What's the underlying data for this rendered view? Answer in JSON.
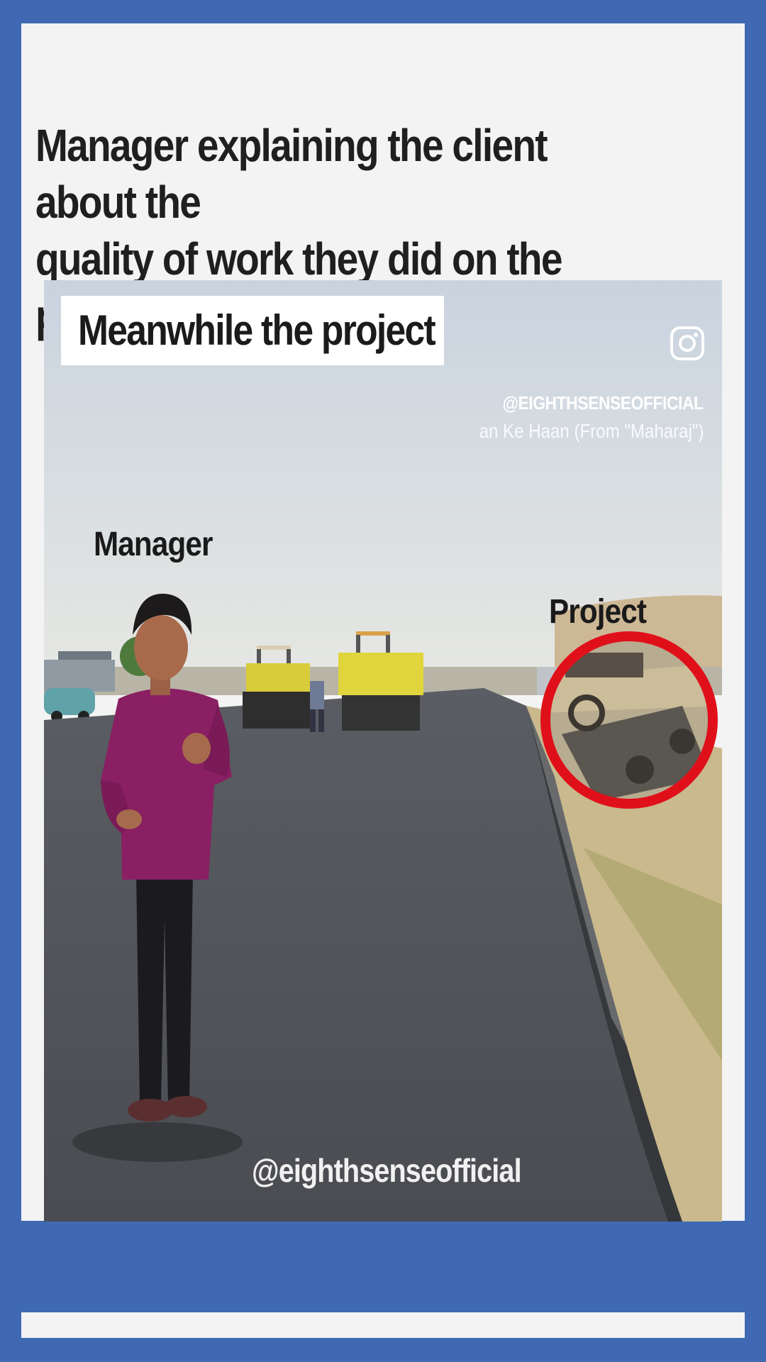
{
  "post": {
    "headline": "Manager explaining the client about the\nquality of work they did on the project"
  },
  "video": {
    "caption": "Meanwhile the project",
    "instagram_icon": "instagram-icon",
    "handle_top": "@EIGHTHSENSEOFFICIAL",
    "song": "an Ke Haan (From \"Maharaj\")",
    "label_manager": "Manager",
    "label_project": "Project",
    "watermark": "@eighthsenseofficial"
  },
  "colors": {
    "frame_blue": "#3f6ab3",
    "card_bg": "#f3f3f3",
    "highlight_circle": "#e0101a"
  }
}
